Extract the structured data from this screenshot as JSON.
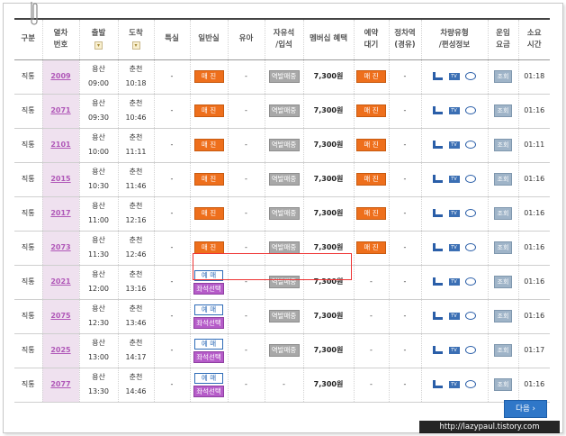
{
  "headers": {
    "category": "구분",
    "train_no": [
      "열차",
      "번호"
    ],
    "departure": "출발",
    "arrival": "도착",
    "special": "특실",
    "general": "일반실",
    "infant": "유아",
    "free_seat": [
      "자유석",
      "/입석"
    ],
    "member_discount": "멤버십 혜택",
    "reservation": [
      "예약",
      "대기"
    ],
    "fixed_period": [
      "정차역",
      "(경유)"
    ],
    "car_type": [
      "차량유형",
      "/편성정보"
    ],
    "fare": [
      "운임",
      "요금"
    ],
    "duration": [
      "소요",
      "시간"
    ],
    "sort_icon": "sort-icon"
  },
  "rows": [
    {
      "type": "직통",
      "no": "2009",
      "dep_st": "용산",
      "dep_t": "09:00",
      "arr_st": "춘천",
      "arr_t": "10:18",
      "special": "-",
      "general": "매 진",
      "general_kind": "sold",
      "infant": "-",
      "free": "역발매중",
      "fare": "7,300원",
      "wait": "매 진",
      "wait_kind": "sold",
      "stop": "-",
      "view": "조회",
      "dur": "01:18"
    },
    {
      "type": "직통",
      "no": "2071",
      "dep_st": "용산",
      "dep_t": "09:30",
      "arr_st": "춘천",
      "arr_t": "10:46",
      "special": "-",
      "general": "매 진",
      "general_kind": "sold",
      "infant": "-",
      "free": "역발매중",
      "fare": "7,300원",
      "wait": "매 진",
      "wait_kind": "sold",
      "stop": "-",
      "view": "조회",
      "dur": "01:16"
    },
    {
      "type": "직통",
      "no": "2101",
      "dep_st": "용산",
      "dep_t": "10:00",
      "arr_st": "춘천",
      "arr_t": "11:11",
      "special": "-",
      "general": "매 진",
      "general_kind": "sold",
      "infant": "-",
      "free": "역발매중",
      "fare": "7,300원",
      "wait": "매 진",
      "wait_kind": "sold",
      "stop": "-",
      "view": "조회",
      "dur": "01:11"
    },
    {
      "type": "직통",
      "no": "2015",
      "dep_st": "용산",
      "dep_t": "10:30",
      "arr_st": "춘천",
      "arr_t": "11:46",
      "special": "-",
      "general": "매 진",
      "general_kind": "sold",
      "infant": "-",
      "free": "역발매중",
      "fare": "7,300원",
      "wait": "매 진",
      "wait_kind": "sold",
      "stop": "-",
      "view": "조회",
      "dur": "01:16"
    },
    {
      "type": "직통",
      "no": "2017",
      "dep_st": "용산",
      "dep_t": "11:00",
      "arr_st": "춘천",
      "arr_t": "12:16",
      "special": "-",
      "general": "매 진",
      "general_kind": "sold",
      "infant": "-",
      "free": "역발매중",
      "fare": "7,300원",
      "wait": "매 진",
      "wait_kind": "sold",
      "stop": "-",
      "view": "조회",
      "dur": "01:16"
    },
    {
      "type": "직통",
      "no": "2073",
      "dep_st": "용산",
      "dep_t": "11:30",
      "arr_st": "춘천",
      "arr_t": "12:46",
      "special": "-",
      "general": "매 진",
      "general_kind": "sold",
      "infant": "-",
      "free": "역발매중",
      "fare": "7,300원",
      "wait": "매 진",
      "wait_kind": "sold",
      "stop": "-",
      "view": "조회",
      "dur": "01:16"
    },
    {
      "type": "직통",
      "no": "2021",
      "dep_st": "용산",
      "dep_t": "12:00",
      "arr_st": "춘천",
      "arr_t": "13:16",
      "special": "-",
      "general": "예 매",
      "general_seat": "좌석선택",
      "general_kind": "book",
      "infant": "-",
      "free": "역발매중",
      "fare": "7,300원",
      "wait": "-",
      "wait_kind": "none",
      "stop": "-",
      "view": "조회",
      "dur": "01:16"
    },
    {
      "type": "직통",
      "no": "2075",
      "dep_st": "용산",
      "dep_t": "12:30",
      "arr_st": "춘천",
      "arr_t": "13:46",
      "special": "-",
      "general": "예 매",
      "general_seat": "좌석선택",
      "general_kind": "book",
      "infant": "-",
      "free": "역발매중",
      "fare": "7,300원",
      "wait": "-",
      "wait_kind": "none",
      "stop": "-",
      "view": "조회",
      "dur": "01:16"
    },
    {
      "type": "직통",
      "no": "2025",
      "dep_st": "용산",
      "dep_t": "13:00",
      "arr_st": "춘천",
      "arr_t": "14:17",
      "special": "-",
      "general": "예 매",
      "general_seat": "좌석선택",
      "general_kind": "book",
      "infant": "-",
      "free": "역발매중",
      "fare": "7,300원",
      "wait": "-",
      "wait_kind": "none",
      "stop": "-",
      "view": "조회",
      "dur": "01:17"
    },
    {
      "type": "직통",
      "no": "2077",
      "dep_st": "용산",
      "dep_t": "13:30",
      "arr_st": "춘천",
      "arr_t": "14:46",
      "special": "-",
      "general": "예 매",
      "general_seat": "좌석선택",
      "general_kind": "book",
      "infant": "-",
      "free": "-",
      "fare": "7,300원",
      "wait": "-",
      "wait_kind": "none",
      "stop": "-",
      "view": "조회",
      "dur": "01:16"
    }
  ],
  "car_icons": [
    "seat-icon",
    "tv-icon",
    "bike-icon"
  ],
  "next_button": "다음 ›",
  "watermark": "http://lazypaul.tistory.com",
  "colors": {
    "sold": "#ee6f1c",
    "book": "#2f6cb8",
    "seat": "#b65cc9",
    "grey": "#a8a8a8",
    "highlight": "#e33333",
    "link": "#b057b8"
  }
}
